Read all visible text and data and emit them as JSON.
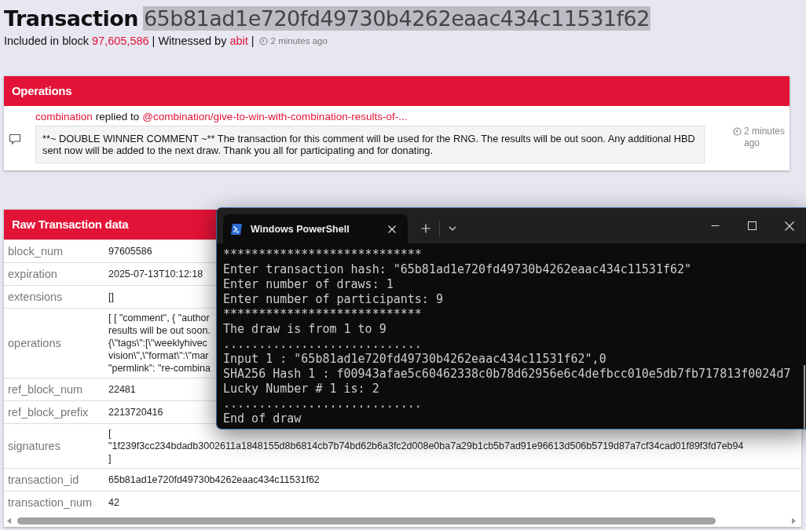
{
  "header": {
    "title": "Transaction",
    "hash": "65b81ad1e720fd49730b4262eaac434c11531f62",
    "included_label": "Included in block",
    "block": "97,605,586",
    "separator_1": "|",
    "witnessed_label": "Witnessed by",
    "witness": "abit",
    "separator_2": "|",
    "time": "2 minutes ago"
  },
  "operations": {
    "title": "Operations",
    "items": [
      {
        "author": "combination",
        "action": "replied to",
        "target": "@combination/give-to-win-with-combination-results-of-...",
        "body": "**~ DOUBLE WINNER COMMENT ~** The transaction for this comment will be used for the RNG. The results will be out soon. Any additional HBD sent now will be added to the next draw. Thank you all for participating and for donating.",
        "time": "2 minutes ago"
      }
    ]
  },
  "raw": {
    "title": "Raw Transaction data",
    "rows": [
      {
        "key": "block_num",
        "lines": [
          "97605586"
        ]
      },
      {
        "key": "expiration",
        "lines": [
          "2025-07-13T10:12:18"
        ]
      },
      {
        "key": "extensions",
        "lines": [
          "[]"
        ]
      },
      {
        "key": "operations",
        "lines": [
          "[ [ \"comment\", { \"author",
          "results will be out soon.",
          "{\\\"tags\\\":[\\\"weeklyhivec",
          "vision\\\",\\\"format\\\":\\\"mar",
          "\"permlink\": \"re-combina"
        ]
      },
      {
        "key": "ref_block_num",
        "lines": [
          "22481"
        ]
      },
      {
        "key": "ref_block_prefix",
        "lines": [
          "2213720416"
        ]
      },
      {
        "key": "signatures",
        "lines": [
          "[",
          "\"1f239f3cc234bdadb3002611a1848155d8b6814cb7b74bd62b6a3fc2d008e0ba7a29b1cb5b7ad91e96613d506b5719d87a7cf34cad01f89f3fd7eb94",
          "]"
        ]
      },
      {
        "key": "transaction_id",
        "lines": [
          "65b81ad1e720fd49730b4262eaac434c11531f62"
        ]
      },
      {
        "key": "transaction_num",
        "lines": [
          "42"
        ]
      }
    ]
  },
  "terminal": {
    "tab_title": "Windows PowerShell",
    "lines": [
      "****************************",
      "Enter transaction hash: \"65b81ad1e720fd49730b4262eaac434c11531f62\"",
      "Enter number of draws: 1",
      "Enter number of participants: 9",
      "****************************",
      "The draw is from 1 to 9",
      "............................",
      "Input 1 : \"65b81ad1e720fd49730b4262eaac434c11531f62\",0",
      "SHA256 Hash 1 : f00943afae5c60462338c0b78d62956e6c4defbcc010e5db7fb717813f0024d7",
      "Lucky Number # 1 is: 2",
      "............................",
      "End of draw"
    ]
  }
}
